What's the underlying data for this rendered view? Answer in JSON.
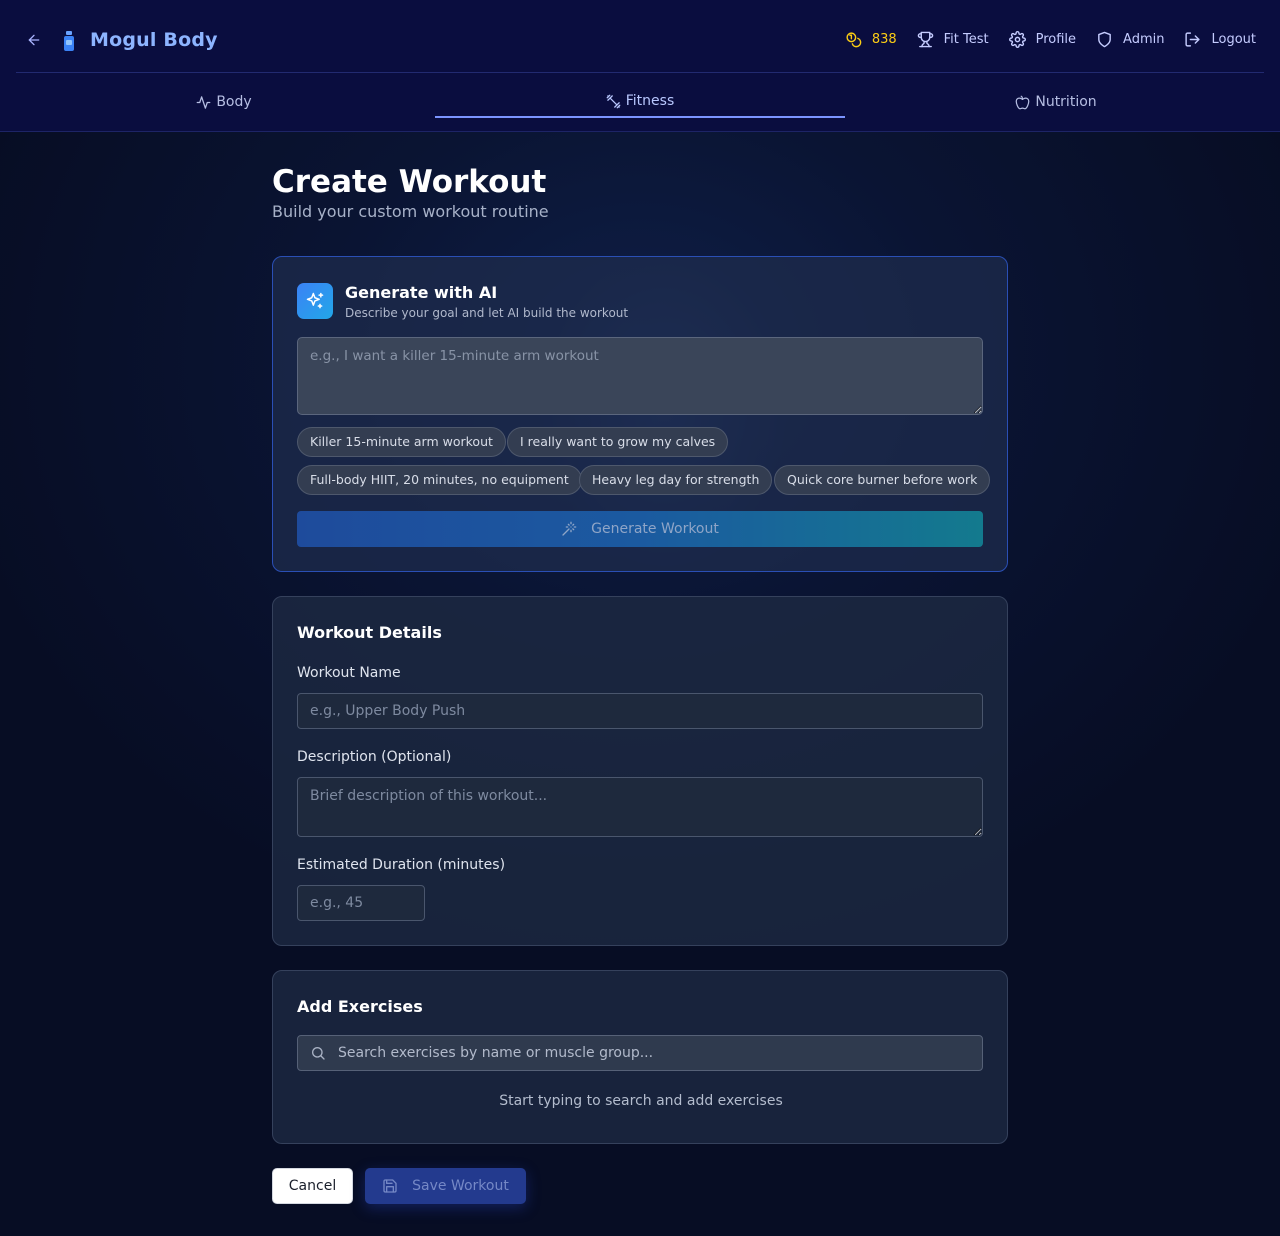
{
  "app": {
    "brand": "Mogul Body"
  },
  "header": {
    "coins": "838",
    "nav": [
      {
        "label": "Fit Test",
        "icon": "trophy-icon"
      },
      {
        "label": "Profile",
        "icon": "gear-icon"
      },
      {
        "label": "Admin",
        "icon": "shield-icon"
      },
      {
        "label": "Logout",
        "icon": "logout-icon"
      }
    ]
  },
  "tabs": [
    {
      "label": "Body",
      "icon": "activity-icon",
      "active": false
    },
    {
      "label": "Fitness",
      "icon": "dumbbell-icon",
      "active": true
    },
    {
      "label": "Nutrition",
      "icon": "apple-icon",
      "active": false
    }
  ],
  "page": {
    "title": "Create Workout",
    "subtitle": "Build your custom workout routine"
  },
  "ai": {
    "title": "Generate with AI",
    "subtitle": "Describe your goal and let AI build the workout",
    "placeholder": "e.g., I want a killer 15-minute arm workout",
    "chips": [
      "Killer 15-minute arm workout",
      "I really want to grow my calves",
      "Full-body HIIT, 20 minutes, no equipment",
      "Heavy leg day for strength",
      "Quick core burner before work"
    ],
    "button": "Generate Workout"
  },
  "details": {
    "title": "Workout Details",
    "name_label": "Workout Name",
    "name_placeholder": "e.g., Upper Body Push",
    "desc_label": "Description (Optional)",
    "desc_placeholder": "Brief description of this workout...",
    "duration_label": "Estimated Duration (minutes)",
    "duration_placeholder": "e.g., 45"
  },
  "exercises": {
    "title": "Add Exercises",
    "search_placeholder": "Search exercises by name or muscle group...",
    "hint": "Start typing to search and add exercises"
  },
  "actions": {
    "cancel": "Cancel",
    "save": "Save Workout"
  },
  "colors": {
    "header_bg": "#0a0d3f",
    "brand": "#8db4ff",
    "coins": "#facc15",
    "accent": "#7b94ff"
  }
}
